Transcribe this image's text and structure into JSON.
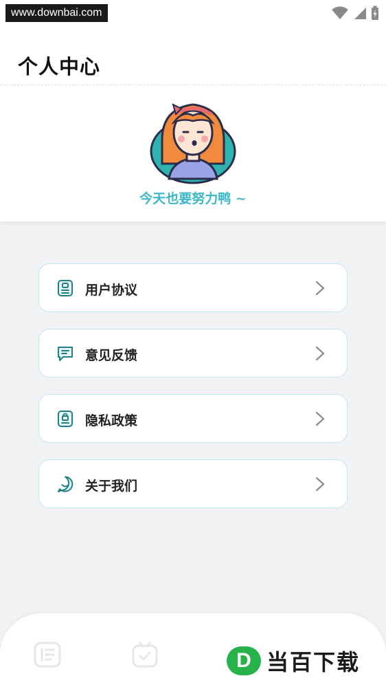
{
  "status_bar": {
    "watermark_text": "www.downbai.com",
    "icons": [
      "wifi-icon",
      "signal-icon",
      "battery-charging-icon"
    ]
  },
  "header": {
    "title": "个人中心"
  },
  "profile": {
    "avatar_icon": "girl-avatar-illustration",
    "slogan": "今天也要努力鸭 ~"
  },
  "menu": {
    "items": [
      {
        "label": "用户协议",
        "icon": "user-badge-icon"
      },
      {
        "label": "意见反馈",
        "icon": "chat-message-icon"
      },
      {
        "label": "隐私政策",
        "icon": "lock-document-icon"
      },
      {
        "label": "关于我们",
        "icon": "smile-chat-icon"
      }
    ],
    "border_color": "#bfe8ee",
    "icon_color": "#1f7f86"
  },
  "bottom_nav": {
    "icons": [
      "list-icon",
      "check-calendar-icon"
    ]
  },
  "brand": {
    "logo_letter": "D",
    "text": "当百下载",
    "color": "#27b34a"
  },
  "colors": {
    "accent": "#3ab8c8",
    "background": "#f1f2f4"
  }
}
